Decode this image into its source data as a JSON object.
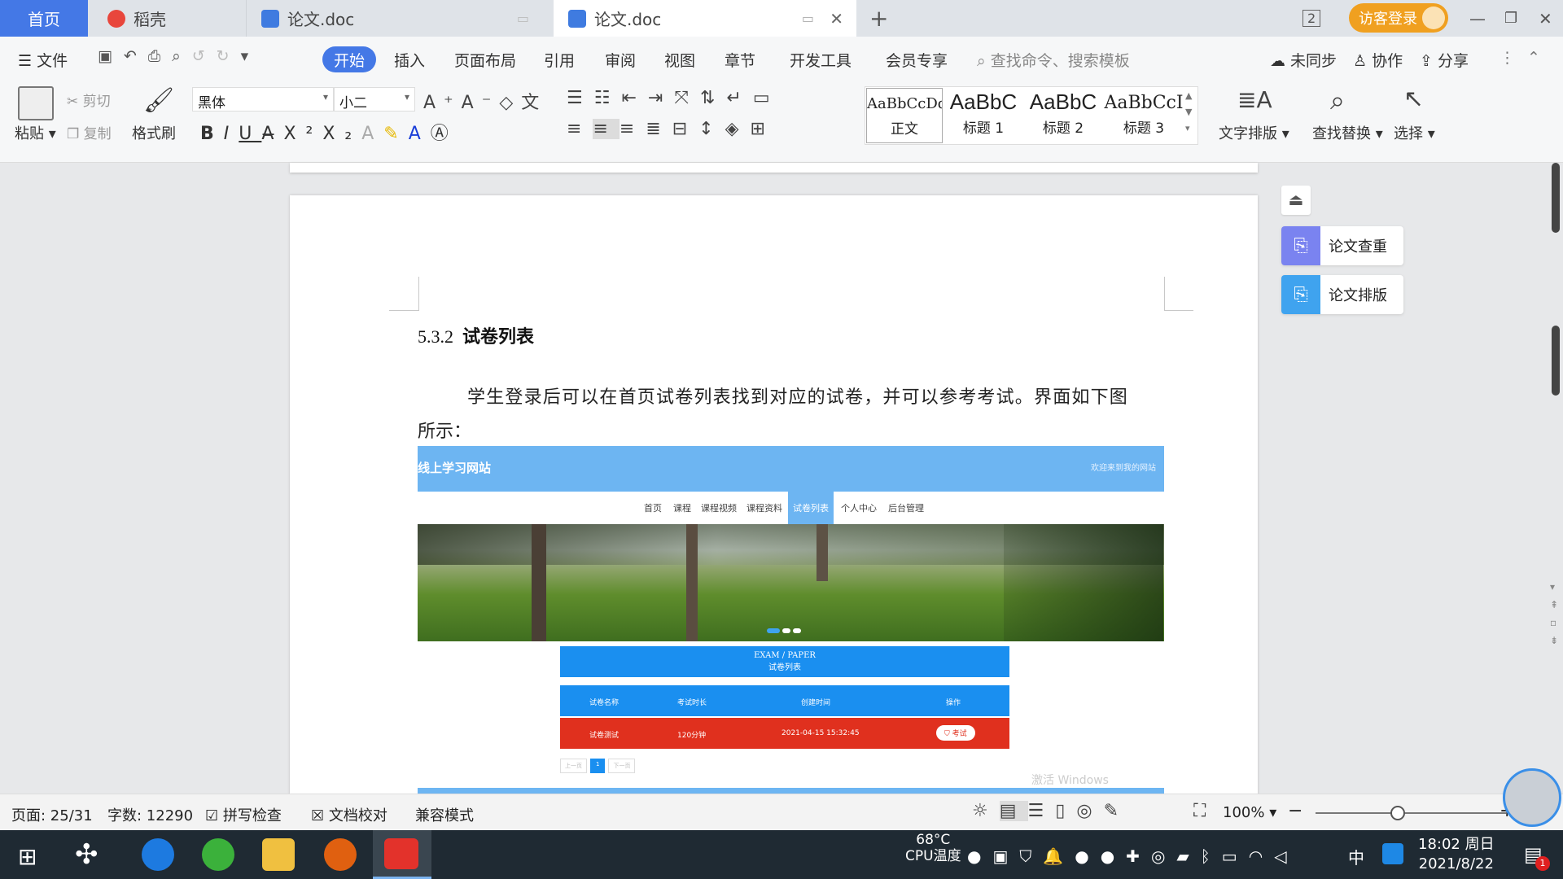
{
  "titlebar": {
    "tabs": [
      {
        "label": "首页",
        "active": false
      },
      {
        "label": "稻壳"
      },
      {
        "label": "论文.doc"
      },
      {
        "label": "论文.doc",
        "active": true
      }
    ],
    "guest_login": "访客登录",
    "window_count": "2"
  },
  "menubar": {
    "file": "文件",
    "items": [
      "开始",
      "插入",
      "页面布局",
      "引用",
      "审阅",
      "视图",
      "章节",
      "开发工具",
      "会员专享"
    ],
    "search_placeholder": "查找命令、搜索模板",
    "sync": "未同步",
    "collab": "协作",
    "share": "分享"
  },
  "ribbon": {
    "paste": "粘贴",
    "cut": "剪切",
    "copy": "复制",
    "format_painter": "格式刷",
    "font_name": "黑体",
    "font_size": "小二",
    "styles": [
      {
        "preview": "AaBbCcDd",
        "label": "正文"
      },
      {
        "preview": "AaBbC",
        "label": "标题 1"
      },
      {
        "preview": "AaBbC",
        "label": "标题 2"
      },
      {
        "preview": "AaBbCcI",
        "label": "标题 3"
      }
    ],
    "text_layout": "文字排版",
    "find_replace": "查找替换",
    "select": "选择"
  },
  "document": {
    "heading_num": "5.3.2",
    "heading_text": "试卷列表",
    "paragraph_line1": "学生登录后可以在首页试卷列表找到对应的试卷，并可以参考考试。界面如下图",
    "paragraph_line2": "所示："
  },
  "embedded_site": {
    "site_title": "线上学习网站",
    "welcome": "欢迎来到我的网站",
    "nav": [
      "首页",
      "课程",
      "课程视频",
      "课程资料",
      "试卷列表",
      "个人中心",
      "后台管理"
    ],
    "nav_active_index": 4,
    "section_en": "EXAM / PAPER",
    "section_cn": "试卷列表",
    "table_headers": [
      "试卷名称",
      "考试时长",
      "创建时间",
      "操作"
    ],
    "table_row": [
      "试卷测试",
      "120分钟",
      "2021-04-15 15:32:45",
      "考试"
    ],
    "pager": [
      "上一页",
      "1",
      "下一页"
    ],
    "watermark": "激活 Windows"
  },
  "side_panel": {
    "paper_check": "论文查重",
    "paper_layout": "论文排版"
  },
  "statusbar": {
    "page": "页面: 25/31",
    "words": "字数: 12290",
    "spellcheck": "拼写检查",
    "doc_proof": "文档校对",
    "compat": "兼容模式",
    "zoom": "100%"
  },
  "taskbar": {
    "cpu_temp": "68°C",
    "cpu_label": "CPU温度",
    "ime": "中",
    "time": "18:02 周日",
    "date": "2021/8/22",
    "notification_count": "1"
  },
  "colors": {
    "accent": "#4478e6",
    "guest_btn": "#f0a020",
    "site_header": "#6db5f2",
    "site_blue": "#1a8ff0",
    "row_red": "#e0301e"
  }
}
